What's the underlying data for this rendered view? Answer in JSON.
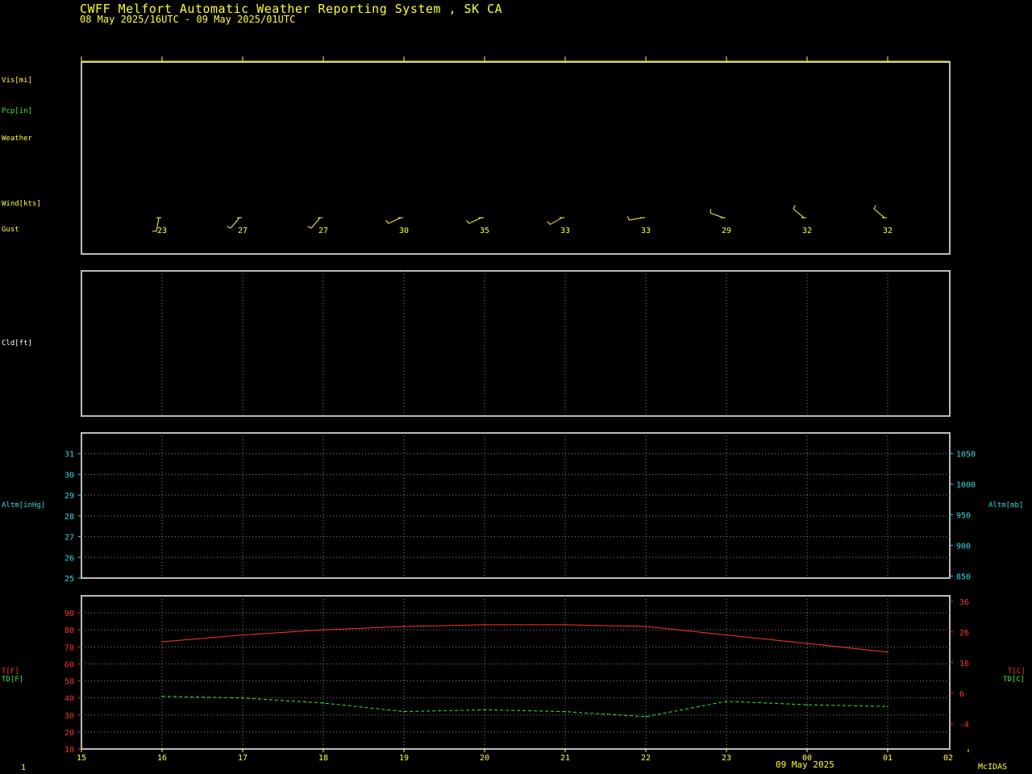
{
  "header": {
    "title": "CWFF  Melfort Automatic Weather Reporting System , SK CA",
    "subtitle": "08 May 2025/16UTC - 09 May 2025/01UTC"
  },
  "labels": {
    "vis": "Vis[mi]",
    "pcp": "Pcp[in]",
    "weather": "Weather",
    "wind": "Wind[kts]",
    "gust": "Gust",
    "cld": "Cld[ft]",
    "altm_inhg": "Altm[inHg]",
    "altm_mb": "Altm[mb]",
    "t_f": "T[F]",
    "td_f": "TD[F]",
    "t_c": "T[C]",
    "td_c": "TD[C]"
  },
  "footer": {
    "date": "09 May 2025",
    "brand": "McIDAS",
    "page": "1"
  },
  "colors": {
    "yellow": "#ffff33",
    "green": "#33ee33",
    "cyan": "#33dddd",
    "red": "#ff3333",
    "frame": "#bbbbbb"
  },
  "chart_data": {
    "type": "line",
    "x_ticks": [
      "15",
      "16",
      "17",
      "18",
      "19",
      "20",
      "21",
      "22",
      "23",
      "00",
      "01",
      "02"
    ],
    "wind": {
      "hours": [
        "16",
        "17",
        "18",
        "19",
        "20",
        "21",
        "22",
        "23",
        "00",
        "01"
      ],
      "direction_deg": [
        190,
        220,
        220,
        245,
        245,
        240,
        260,
        290,
        310,
        310
      ],
      "gust": [
        "23",
        "27",
        "27",
        "30",
        "35",
        "33",
        "33",
        "29",
        "32",
        "32"
      ]
    },
    "altimeter": {
      "left_axis": {
        "label": "Altm[inHg]",
        "ticks": [
          "25",
          "26",
          "27",
          "28",
          "29",
          "30",
          "31"
        ],
        "ylim": [
          25,
          32
        ]
      },
      "right_axis": {
        "label": "Altm[mb]",
        "ticks": [
          "850",
          "900",
          "950",
          "1000",
          "1050"
        ]
      }
    },
    "temperature": {
      "left_axis": {
        "ticks": [
          "10",
          "20",
          "30",
          "40",
          "50",
          "60",
          "70",
          "80",
          "90"
        ],
        "ylim": [
          10,
          100
        ]
      },
      "right_axis": {
        "ticks": [
          "-4",
          "6",
          "16",
          "26",
          "36"
        ]
      },
      "series": [
        {
          "name": "T[F]",
          "color": "#ff3333",
          "x": [
            "16",
            "17",
            "18",
            "19",
            "20",
            "21",
            "22",
            "23",
            "00",
            "01"
          ],
          "values": [
            73,
            77,
            80,
            82,
            83,
            83,
            82,
            77,
            72,
            67
          ]
        },
        {
          "name": "TD[F]",
          "color": "#33ee33",
          "x": [
            "16",
            "17",
            "18",
            "19",
            "20",
            "21",
            "22",
            "23",
            "00",
            "01"
          ],
          "values": [
            41,
            40,
            37,
            32,
            33,
            32,
            29,
            38,
            36,
            35
          ]
        }
      ]
    }
  }
}
